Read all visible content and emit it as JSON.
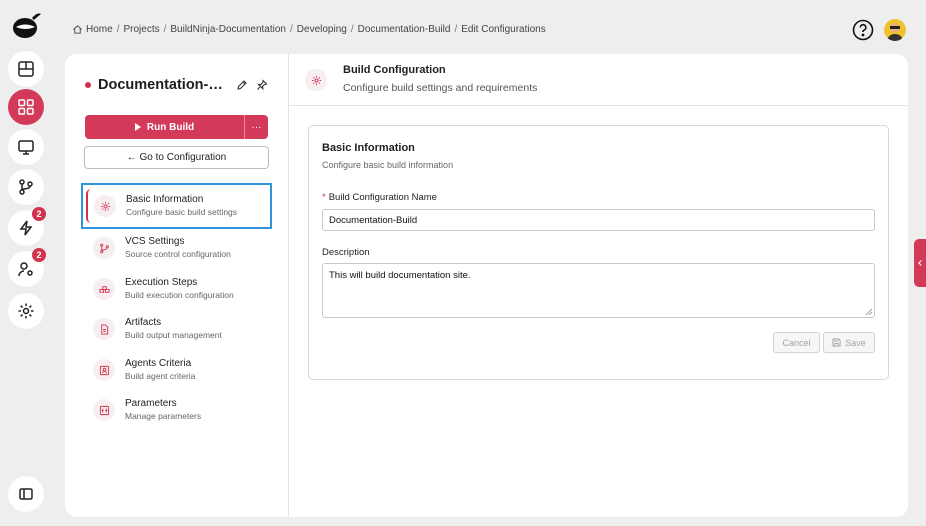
{
  "breadcrumb": [
    "Home",
    "Projects",
    "BuildNinja-Documentation",
    "Developing",
    "Documentation-Build",
    "Edit Configurations"
  ],
  "rail": {
    "badges": {
      "builds": "2",
      "agents": "2"
    }
  },
  "sidebar": {
    "title": "Documentation-Build",
    "run_label": "Run Build",
    "more_label": "···",
    "goto_label": "← Go to Configuration",
    "items": [
      {
        "label": "Basic Information",
        "desc": "Configure basic build settings",
        "icon": "gear-icon"
      },
      {
        "label": "VCS Settings",
        "desc": "Source control configuration",
        "icon": "branch-icon"
      },
      {
        "label": "Execution Steps",
        "desc": "Build execution configuration",
        "icon": "steps-icon"
      },
      {
        "label": "Artifacts",
        "desc": "Build output management",
        "icon": "file-icon"
      },
      {
        "label": "Agents Criteria",
        "desc": "Build agent criteria",
        "icon": "agent-icon"
      },
      {
        "label": "Parameters",
        "desc": "Manage parameters",
        "icon": "parameters-icon"
      }
    ]
  },
  "main": {
    "header_title": "Build Configuration",
    "header_sub": "Configure build settings and requirements",
    "card_title": "Basic Information",
    "card_sub": "Configure basic build information",
    "name_label": "Build Configuration Name",
    "name_required": "*",
    "name_value": "Documentation-Build",
    "desc_label": "Description",
    "desc_value": "This will build documentation site.",
    "cancel_label": "Cancel",
    "save_label": "Save"
  },
  "colors": {
    "accent": "#d33a5a",
    "selection": "#2f93dd"
  }
}
